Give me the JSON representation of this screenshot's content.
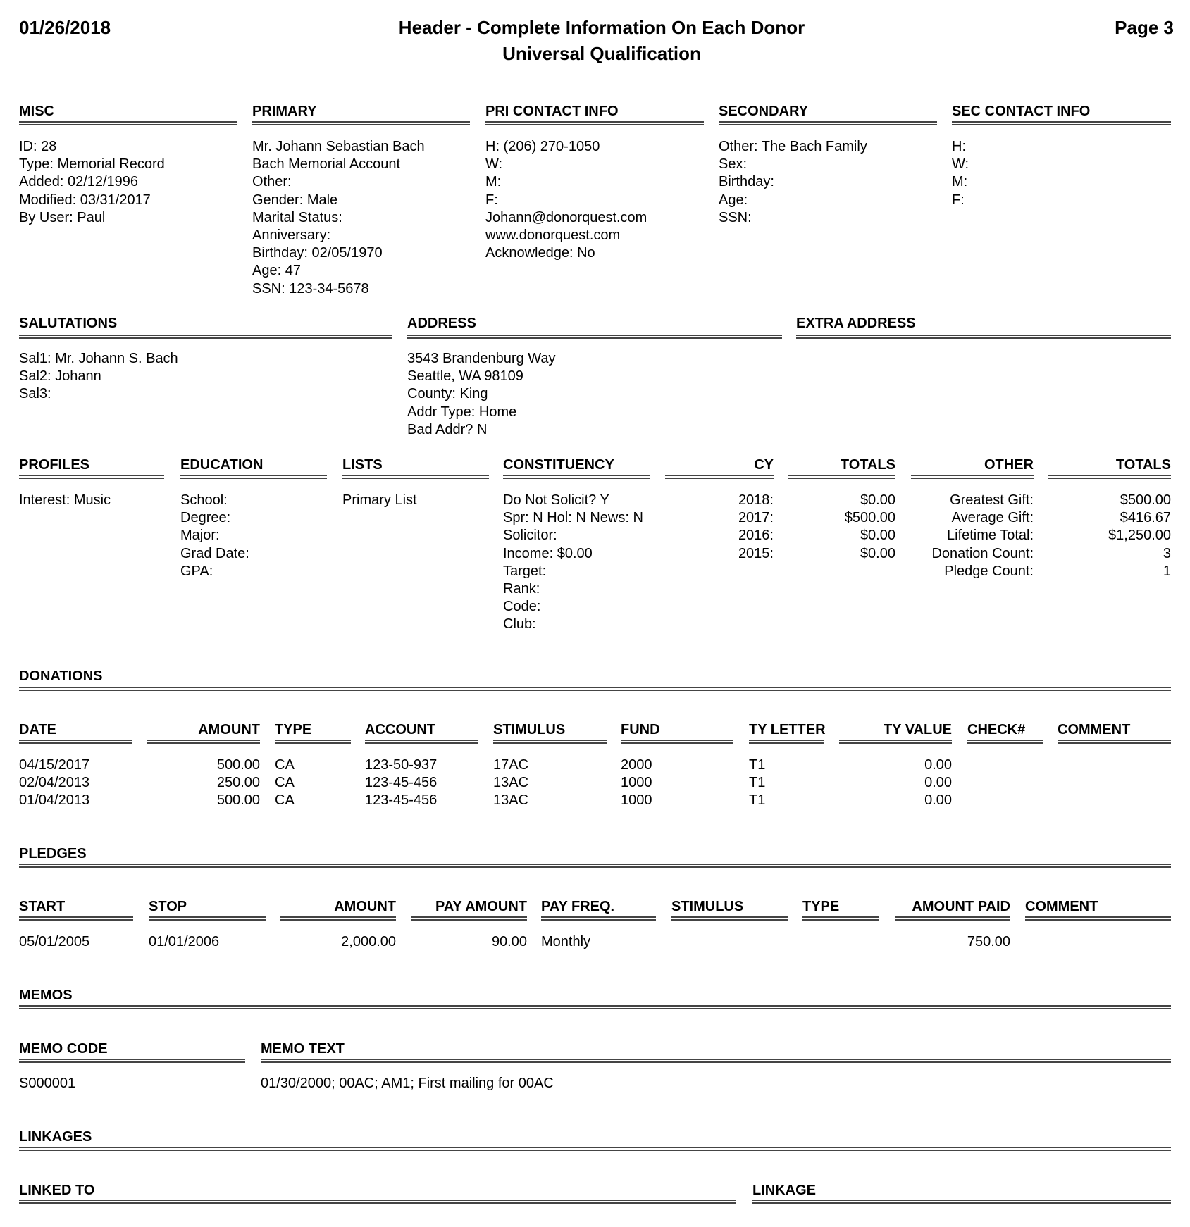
{
  "header": {
    "date": "01/26/2018",
    "title": "Header - Complete Information On Each Donor",
    "subtitle": "Universal Qualification",
    "page": "Page 3"
  },
  "misc": {
    "heading": "MISC",
    "lines": [
      "ID: 28",
      "Type: Memorial Record",
      "Added: 02/12/1996",
      "Modified: 03/31/2017",
      "By User: Paul"
    ]
  },
  "primary": {
    "heading": "PRIMARY",
    "lines": [
      "Mr. Johann Sebastian Bach",
      "Bach Memorial Account",
      "Other:",
      "Gender: Male",
      "Marital Status:",
      "Anniversary:",
      "Birthday: 02/05/1970",
      "Age: 47",
      "SSN: 123-34-5678"
    ]
  },
  "pri_contact": {
    "heading": "PRI CONTACT INFO",
    "lines": [
      "H: (206) 270-1050",
      "W:",
      "M:",
      "F:",
      "Johann@donorquest.com",
      "www.donorquest.com",
      "Acknowledge: No"
    ]
  },
  "secondary": {
    "heading": "SECONDARY",
    "lines": [
      "Other: The Bach Family",
      "Sex:",
      "Birthday:",
      "Age:",
      "SSN:"
    ]
  },
  "sec_contact": {
    "heading": "SEC CONTACT INFO",
    "lines": [
      "H:",
      "W:",
      "M:",
      "F:"
    ]
  },
  "salutations": {
    "heading": "SALUTATIONS",
    "lines": [
      "Sal1: Mr. Johann S. Bach",
      "Sal2: Johann",
      "Sal3:"
    ]
  },
  "address": {
    "heading": "ADDRESS",
    "lines": [
      "3543 Brandenburg Way",
      "Seattle, WA 98109",
      "County: King",
      "Addr Type: Home",
      "Bad Addr? N"
    ]
  },
  "extra_address": {
    "heading": "EXTRA ADDRESS",
    "lines": []
  },
  "profiles": {
    "heading": "PROFILES",
    "lines": [
      "Interest: Music"
    ]
  },
  "education": {
    "heading": "EDUCATION",
    "lines": [
      "School:",
      "Degree:",
      "Major:",
      "Grad Date:",
      "GPA:"
    ]
  },
  "lists": {
    "heading": "LISTS",
    "lines": [
      "Primary List"
    ]
  },
  "constituency": {
    "heading": "CONSTITUENCY",
    "lines": [
      "Do Not Solicit? Y",
      "Spr: N Hol: N News: N",
      "Solicitor:",
      "Income: $0.00",
      "Target:",
      "Rank:",
      "Code:",
      "Club:"
    ]
  },
  "cy": {
    "heading": "CY",
    "lines": [
      "2018:",
      "2017:",
      "2016:",
      "2015:"
    ]
  },
  "cy_totals": {
    "heading": "TOTALS",
    "lines": [
      "$0.00",
      "$500.00",
      "$0.00",
      "$0.00"
    ]
  },
  "other": {
    "heading": "OTHER",
    "lines": [
      "Greatest Gift:",
      "Average Gift:",
      "Lifetime Total:",
      "Donation Count:",
      "Pledge Count:"
    ]
  },
  "other_totals": {
    "heading": "TOTALS",
    "lines": [
      "$500.00",
      "$416.67",
      "$1,250.00",
      "3",
      "1"
    ]
  },
  "donations": {
    "heading": "DONATIONS",
    "columns": [
      "DATE",
      "AMOUNT",
      "TYPE",
      "ACCOUNT",
      "STIMULUS",
      "FUND",
      "TY LETTER",
      "TY VALUE",
      "CHECK#",
      "COMMENT"
    ],
    "rows": [
      [
        "04/15/2017",
        "500.00",
        "CA",
        "123-50-937",
        "17AC",
        "2000",
        "T1",
        "0.00",
        "",
        ""
      ],
      [
        "02/04/2013",
        "250.00",
        "CA",
        "123-45-456",
        "13AC",
        "1000",
        "T1",
        "0.00",
        "",
        ""
      ],
      [
        "01/04/2013",
        "500.00",
        "CA",
        "123-45-456",
        "13AC",
        "1000",
        "T1",
        "0.00",
        "",
        ""
      ]
    ]
  },
  "pledges": {
    "heading": "PLEDGES",
    "columns": [
      "START",
      "STOP",
      "AMOUNT",
      "PAY AMOUNT",
      "PAY FREQ.",
      "STIMULUS",
      "TYPE",
      "AMOUNT PAID",
      "COMMENT"
    ],
    "rows": [
      [
        "05/01/2005",
        "01/01/2006",
        "2,000.00",
        "90.00",
        "Monthly",
        "",
        "",
        "750.00",
        ""
      ]
    ]
  },
  "memos": {
    "heading": "MEMOS",
    "columns": [
      "MEMO CODE",
      "MEMO TEXT"
    ],
    "rows": [
      [
        "S000001",
        "01/30/2000; 00AC; AM1; First mailing for 00AC"
      ]
    ]
  },
  "linkages": {
    "heading": "LINKAGES",
    "columns": [
      "LINKED TO",
      "LINKAGE"
    ],
    "rows": []
  }
}
